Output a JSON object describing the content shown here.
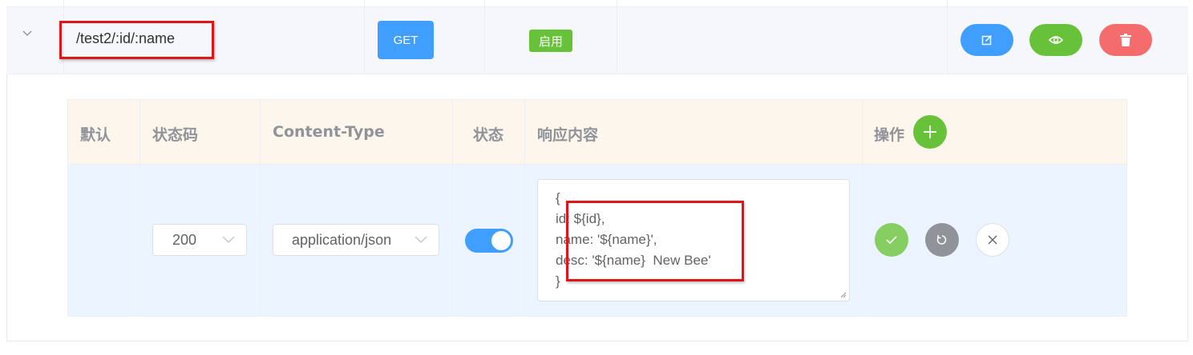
{
  "route": {
    "path": "/test2/:id/:name",
    "method": "GET",
    "status": "启用"
  },
  "row_actions": [
    {
      "name": "edit-button",
      "icon": "edit-icon",
      "color": "#409eff"
    },
    {
      "name": "preview-button",
      "icon": "eye-icon",
      "color": "#67c23a"
    },
    {
      "name": "delete-button",
      "icon": "trash-icon",
      "color": "#f56c6c"
    }
  ],
  "responses_table": {
    "headers": {
      "default": "默认",
      "status_code": "状态码",
      "content_type": "Content-Type",
      "status": "状态",
      "body": "响应内容",
      "actions": "操作"
    },
    "row": {
      "status_code": "200",
      "content_type": "application/json",
      "enabled": true,
      "body_lines": [
        "{",
        "id: ${id},",
        "name: '${name}',",
        "desc: '${name}  New Bee'",
        "}"
      ]
    },
    "row_actions": [
      {
        "name": "confirm-button",
        "icon": "check-icon",
        "color": "#85ce61"
      },
      {
        "name": "reset-button",
        "icon": "refresh-icon",
        "color": "#909399"
      },
      {
        "name": "cancel-button",
        "icon": "close-icon",
        "color": "#ffffff"
      }
    ]
  },
  "colors": {
    "primary": "#409eff",
    "success": "#67c23a",
    "danger": "#f56c6c",
    "highlight_box": "#e0151a"
  }
}
